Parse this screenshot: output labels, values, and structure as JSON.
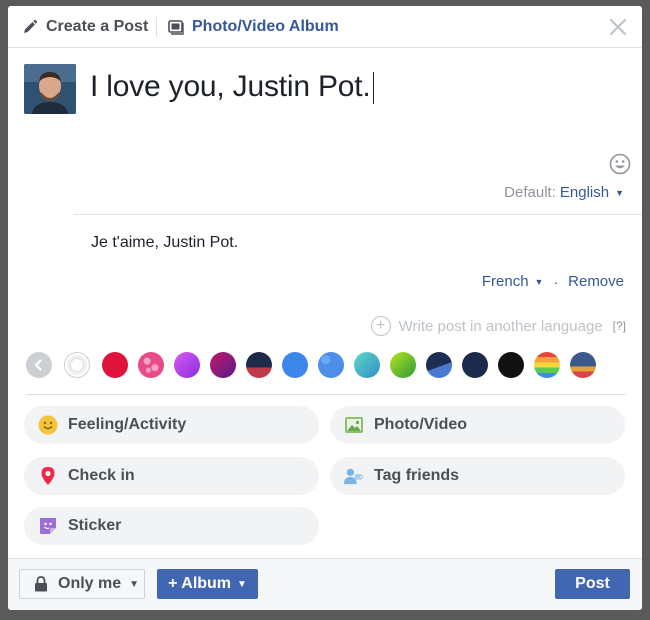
{
  "header": {
    "create_post_label": "Create a Post",
    "album_label": "Photo/Video Album"
  },
  "composer": {
    "post_text": "I love you, Justin Pot.",
    "default_label": "Default:",
    "default_language": "English",
    "translation_text": "Je t'aime, Justin Pot.",
    "translation_language": "French",
    "remove_label": "Remove",
    "another_language_label": "Write post in another language",
    "help_label": "[?]"
  },
  "swatches": [
    {
      "name": "back",
      "color": "#ccd0d5"
    },
    {
      "name": "white",
      "color": "#ffffff"
    },
    {
      "name": "red",
      "color": "#e0133d"
    },
    {
      "name": "pink-pattern",
      "color": "#e84a8a"
    },
    {
      "name": "purple-gradient",
      "color": "#b23ff0"
    },
    {
      "name": "magenta-gradient",
      "color": "#8b1f8f"
    },
    {
      "name": "dark-navy-image",
      "color": "#2d3a5a"
    },
    {
      "name": "blue",
      "color": "#3d86ea"
    },
    {
      "name": "blue-pattern",
      "color": "#4c8ee8"
    },
    {
      "name": "teal-gradient",
      "color": "#3fb8b0"
    },
    {
      "name": "green-gradient",
      "color": "#7cc21a"
    },
    {
      "name": "night-image",
      "color": "#1e2d52"
    },
    {
      "name": "navy",
      "color": "#1c2a4d"
    },
    {
      "name": "black",
      "color": "#111111"
    },
    {
      "name": "rainbow",
      "color": "#f2a13c"
    },
    {
      "name": "scene-image",
      "color": "#3b5a8a"
    }
  ],
  "actions": {
    "feeling_label": "Feeling/Activity",
    "photo_label": "Photo/Video",
    "checkin_label": "Check in",
    "tag_label": "Tag friends",
    "sticker_label": "Sticker"
  },
  "footer": {
    "privacy_label": "Only me",
    "album_label": "+ Album",
    "post_label": "Post"
  },
  "colors": {
    "fb_blue": "#4267b2",
    "link_blue": "#365899",
    "pill_bg": "#f2f3f5"
  }
}
